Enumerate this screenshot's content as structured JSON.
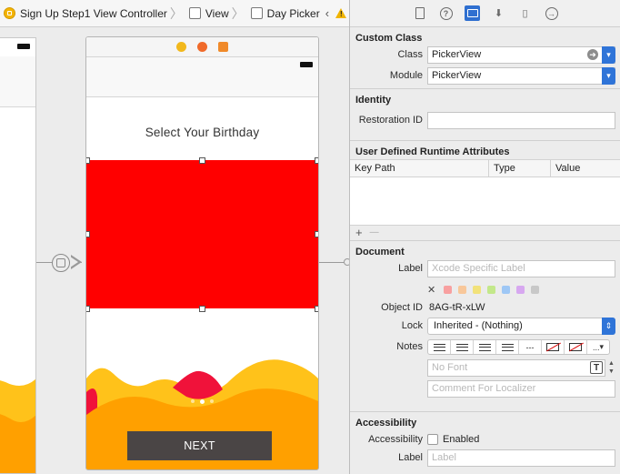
{
  "breadcrumb": {
    "items": [
      "Sign Up Step1 View Controller",
      "View",
      "Day Picker"
    ],
    "back_glyph": "‹",
    "forward_glyph": "›",
    "warning_icon": "warning-icon"
  },
  "canvas": {
    "scene_title": "Select Your Birthday",
    "next_button": "NEXT",
    "picker_color": "#ff0000",
    "page_dots": 3,
    "active_dot": 2
  },
  "inspector": {
    "tabs": [
      "file-icon",
      "help-icon",
      "identity-icon",
      "attributes-icon",
      "size-icon",
      "connections-icon"
    ],
    "selected_tab": "identity-icon",
    "custom_class": {
      "title": "Custom Class",
      "class_label": "Class",
      "class_value": "PickerView",
      "module_label": "Module",
      "module_value": "PickerView"
    },
    "identity": {
      "title": "Identity",
      "restoration_label": "Restoration ID",
      "restoration_value": ""
    },
    "runtime_attributes": {
      "title": "User Defined Runtime Attributes",
      "columns": [
        "Key Path",
        "Type",
        "Value"
      ],
      "add_glyph": "+",
      "remove_glyph": "—"
    },
    "document": {
      "title": "Document",
      "label_label": "Label",
      "label_placeholder": "Xcode Specific Label",
      "clear_glyph": "✕",
      "swatch_colors": [
        "#f8a0a0",
        "#f8c79a",
        "#f2e27a",
        "#c3e88a",
        "#9ec7f5",
        "#d7a8f0",
        "#c8c8c8"
      ],
      "object_id_label": "Object ID",
      "object_id_value": "8AG-tR-xLW",
      "lock_label": "Lock",
      "lock_value": "Inherited - (Nothing)",
      "notes_label": "Notes",
      "notes_more": "...",
      "font_placeholder": "No Font",
      "comment_placeholder": "Comment For Localizer"
    },
    "accessibility": {
      "title": "Accessibility",
      "accessibility_label": "Accessibility",
      "enabled_label": "Enabled",
      "enabled_checked": false,
      "label_label": "Label",
      "label_placeholder": "Label"
    }
  }
}
